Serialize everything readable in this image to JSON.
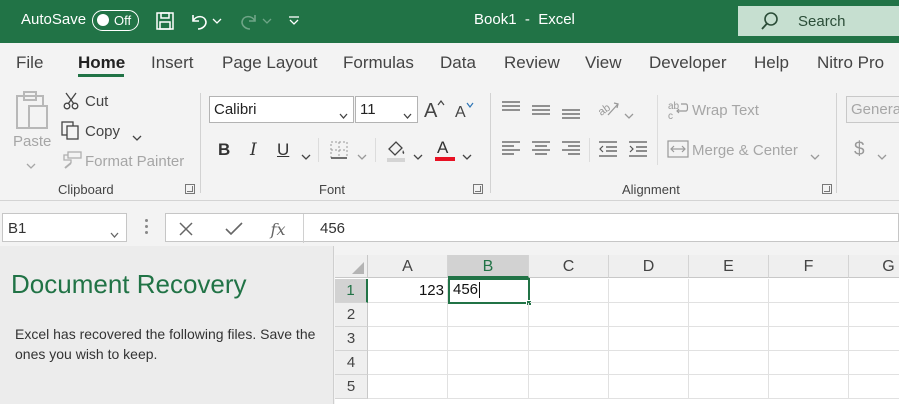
{
  "titlebar": {
    "autosave_label": "AutoSave",
    "autosave_state": "Off",
    "title": "Book1  -  Excel",
    "search_placeholder": "Search",
    "icons": [
      "save-icon",
      "undo-icon",
      "redo-icon",
      "customize-qat-icon",
      "search-icon"
    ]
  },
  "tabs": [
    "File",
    "Home",
    "Insert",
    "Page Layout",
    "Formulas",
    "Data",
    "Review",
    "View",
    "Developer",
    "Help",
    "Nitro Pro"
  ],
  "active_tab": "Home",
  "ribbon": {
    "clipboard": {
      "label": "Clipboard",
      "paste": "Paste",
      "cut": "Cut",
      "copy": "Copy",
      "format_painter": "Format Painter"
    },
    "font": {
      "label": "Font",
      "font_name": "Calibri",
      "font_size": "11",
      "bold": "B",
      "italic": "I",
      "underline": "U",
      "font_color_glyph": "A",
      "font_color": "#e81123"
    },
    "alignment": {
      "label": "Alignment",
      "wrap_text": "Wrap Text",
      "merge_center": "Merge & Center"
    },
    "number": {
      "format": "General",
      "currency_glyph": "$"
    }
  },
  "formula_bar": {
    "name_box": "B1",
    "content": "456",
    "fx": "fx"
  },
  "recovery": {
    "title": "Document Recovery",
    "message": "Excel has recovered the following files.  Save the ones you wish to keep."
  },
  "grid": {
    "columns": [
      "A",
      "B",
      "C",
      "D",
      "E",
      "F",
      "G"
    ],
    "rows": [
      "1",
      "2",
      "3",
      "4",
      "5"
    ],
    "selected_column": "B",
    "selected_row": "1",
    "cells": {
      "A1": "123",
      "B1": "456"
    }
  },
  "colors": {
    "accent": "#217346",
    "search_bg": "#c6dfd0"
  }
}
